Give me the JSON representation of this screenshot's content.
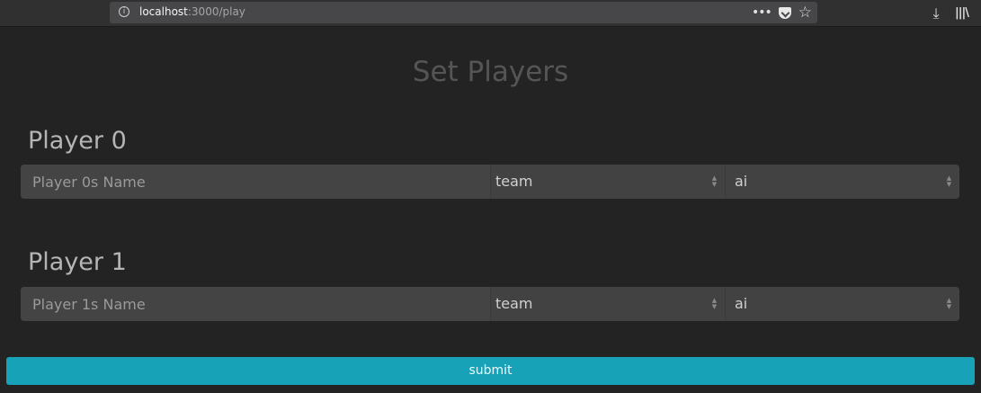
{
  "browser": {
    "url_host": "localhost",
    "url_path": ":3000/play",
    "info_icon": "info-icon",
    "page_actions_icon": "…",
    "download_icon": "download-icon",
    "library_icon": "library-icon"
  },
  "page": {
    "title": "Set Players"
  },
  "players": [
    {
      "heading": "Player 0",
      "name_placeholder": "Player 0s Name",
      "name_value": "",
      "team_selected": "team",
      "type_selected": "ai"
    },
    {
      "heading": "Player 1",
      "name_placeholder": "Player 1s Name",
      "name_value": "",
      "team_selected": "team",
      "type_selected": "ai"
    }
  ],
  "submit_label": "submit",
  "colors": {
    "background": "#232323",
    "accent": "#18a2b8"
  }
}
